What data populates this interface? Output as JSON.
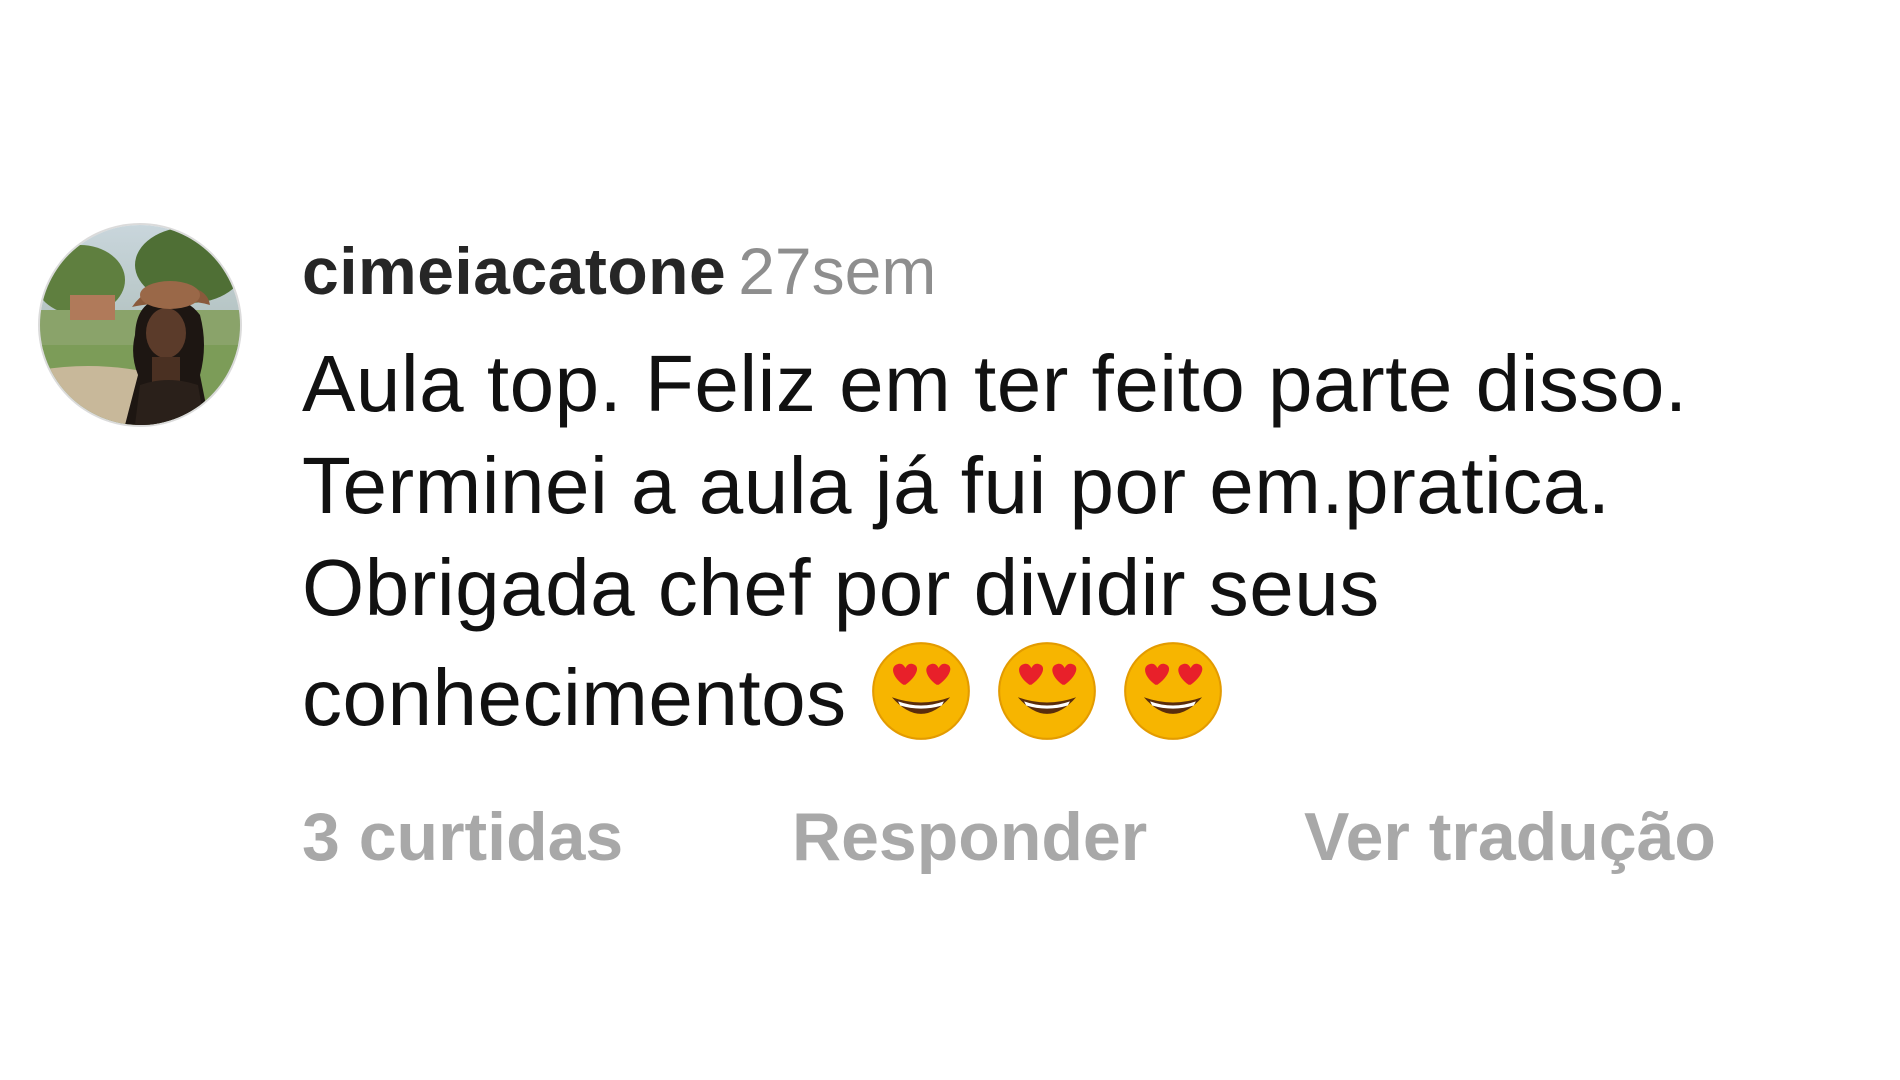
{
  "comment": {
    "avatar_icon": "profile-photo-avatar",
    "username": "cimeiacatone",
    "time_ago": "27sem",
    "text_lines": [
      "Aula top. Feliz em ter feito parte disso.",
      "Terminei a aula já fui por em.pratica.",
      "Obrigada chef por dividir seus",
      "conhecimentos"
    ],
    "emoji_icon": "heart-eyes-emoji",
    "emoji_count": 3,
    "likes_label": "3 curtidas",
    "reply_label": "Responder",
    "translate_label": "Ver tradução"
  },
  "colors": {
    "username": "#262626",
    "secondary_text": "#8e8e8e",
    "body_text": "#111111",
    "action_text": "#a8a8a8",
    "background": "#ffffff"
  }
}
